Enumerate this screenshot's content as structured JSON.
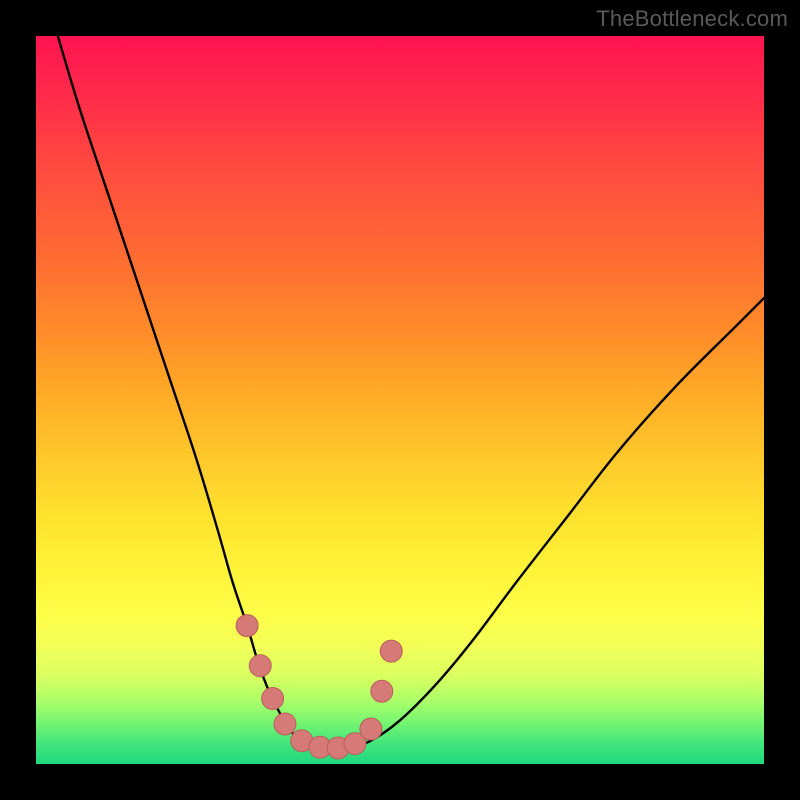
{
  "watermark": "TheBottleneck.com",
  "colors": {
    "frame": "#000000",
    "curve": "#000000",
    "marker_fill": "#d57a77",
    "marker_stroke": "#b85e5b"
  },
  "chart_data": {
    "type": "line",
    "title": "",
    "xlabel": "",
    "ylabel": "",
    "xlim": [
      0,
      100
    ],
    "ylim": [
      0,
      100
    ],
    "grid": false,
    "series": [
      {
        "name": "curve",
        "x": [
          3,
          6,
          10,
          14,
          18,
          22,
          25,
          27,
          29,
          30.5,
          32,
          33.5,
          35,
          37,
          39,
          41,
          43,
          46,
          50,
          55,
          60,
          66,
          73,
          80,
          88,
          96,
          100
        ],
        "y": [
          100,
          90,
          78,
          66,
          54,
          42,
          32,
          25,
          19,
          14,
          10,
          7,
          4.5,
          3,
          2.2,
          2,
          2.2,
          3.2,
          6,
          11,
          17,
          25,
          34,
          43,
          52,
          60,
          64
        ]
      }
    ],
    "markers": [
      {
        "x": 29.0,
        "y": 19.0
      },
      {
        "x": 30.8,
        "y": 13.5
      },
      {
        "x": 32.5,
        "y": 9.0
      },
      {
        "x": 34.2,
        "y": 5.5
      },
      {
        "x": 36.5,
        "y": 3.2
      },
      {
        "x": 39.0,
        "y": 2.3
      },
      {
        "x": 41.5,
        "y": 2.2
      },
      {
        "x": 43.8,
        "y": 2.8
      },
      {
        "x": 46.0,
        "y": 4.8
      },
      {
        "x": 47.5,
        "y": 10.0
      },
      {
        "x": 48.8,
        "y": 15.5
      }
    ]
  }
}
